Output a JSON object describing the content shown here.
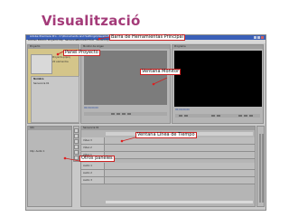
{
  "slide": {
    "title": "Visualització",
    "title_color": "#a43b79"
  },
  "app": {
    "window_title": "Adobe Premiere Pro - C:\\Documents and Settings\\Usuario\\Mis documentos\\Adobe\\Premiere Pro\\proyecto",
    "menu": [
      "Archivo",
      "Edición",
      "Proyecto",
      "Clip",
      "Secuencia",
      "Marcador",
      "Título",
      "Ventana",
      "Ayuda"
    ],
    "accent_color": "#3a5fb8"
  },
  "panels": {
    "project_tab": "Proyecto",
    "project_rows": [
      "Proyecto.prproj",
      "20 elementos"
    ],
    "project_list": [
      "Nombre",
      "Secuencia 01"
    ],
    "source_tab": "Monitor de origen",
    "program_tab": "Programa",
    "timeline_tab": "Secuencia 01",
    "effects_tab": "Info",
    "effects_row": "Clip: Audio 1",
    "timecode_source": "00;00;00;00",
    "timecode_program": "00;00;00;00",
    "tracks": [
      "Vídeo 3",
      "Vídeo 2",
      "Vídeo 1",
      "Audio 1",
      "Audio 2",
      "Audio 3"
    ]
  },
  "callouts": {
    "main_toolbar": "Barra de Herramientas Principal",
    "project_panel": "Panel Proyecto",
    "monitor_window": "Ventana Monitor",
    "timeline_window": "Ventana Línea de Tiempo",
    "other_panels": "Otros paneles",
    "callout_color": "#cc2222"
  }
}
